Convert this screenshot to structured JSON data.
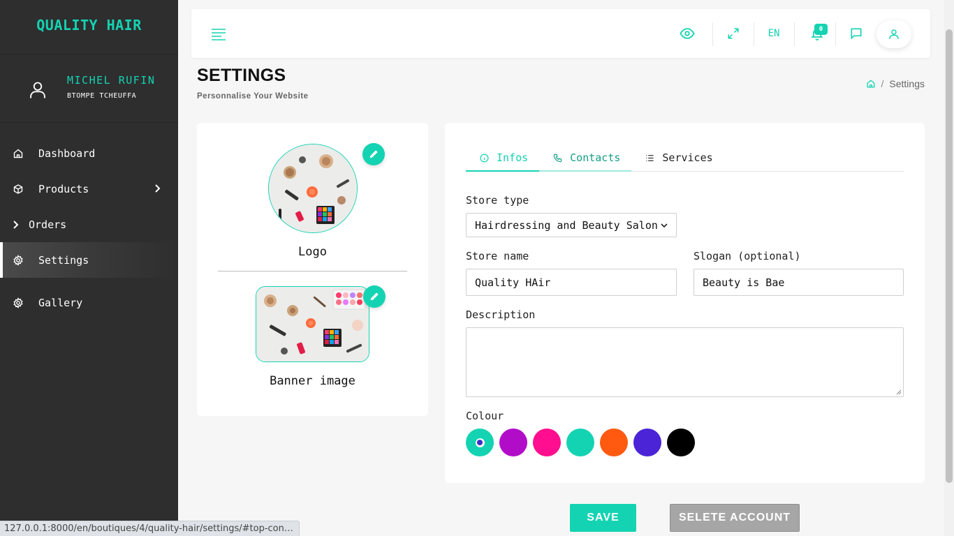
{
  "brand": {
    "name": "QUALITY HAIR"
  },
  "user": {
    "first_name": "MICHEL RUFIN",
    "last_name": "BTOMPE TCHEUFFA"
  },
  "sidebar": {
    "items": [
      {
        "label": "Dashboard",
        "icon": "home-icon"
      },
      {
        "label": "Products",
        "icon": "box-icon"
      },
      {
        "label": "Orders",
        "icon": "chevron-right-icon"
      },
      {
        "label": "Settings",
        "icon": "gear-icon",
        "active": true
      },
      {
        "label": "Gallery",
        "icon": "gear-icon"
      }
    ]
  },
  "topbar": {
    "language": "EN",
    "notifications_count": "0"
  },
  "page": {
    "title": "SETTINGS",
    "subtitle": "Personnalise Your Website",
    "breadcrumb_current": "Settings"
  },
  "media": {
    "logo_label": "Logo",
    "banner_label": "Banner image"
  },
  "tabs": [
    {
      "label": "Infos",
      "icon": "info-icon",
      "active": true
    },
    {
      "label": "Contacts",
      "icon": "phone-icon"
    },
    {
      "label": "Services",
      "icon": "list-icon"
    }
  ],
  "form": {
    "store_type_label": "Store type",
    "store_type_value": "Hairdressing and Beauty Salon",
    "store_name_label": "Store name",
    "store_name_value": "Quality HAir",
    "slogan_label": "Slogan (optional)",
    "slogan_value": "Beauty is Bae",
    "description_label": "Description",
    "description_value": "",
    "colour_label": "Colour",
    "colours": [
      "#14d3b3",
      "#b10dc9",
      "#ff0f8f",
      "#14d3b3",
      "#ff5a10",
      "#4a24d6",
      "#000000"
    ],
    "selected_colour_index": 0
  },
  "actions": {
    "save_label": "SAVE",
    "delete_label": "SELETE ACCOUNT"
  },
  "status_bar": {
    "url": "127.0.0.1:8000/en/boutiques/4/quality-hair/settings/#top-con…"
  },
  "colors": {
    "accent": "#14d3b3",
    "sidebar_bg": "#2e2e2e"
  }
}
